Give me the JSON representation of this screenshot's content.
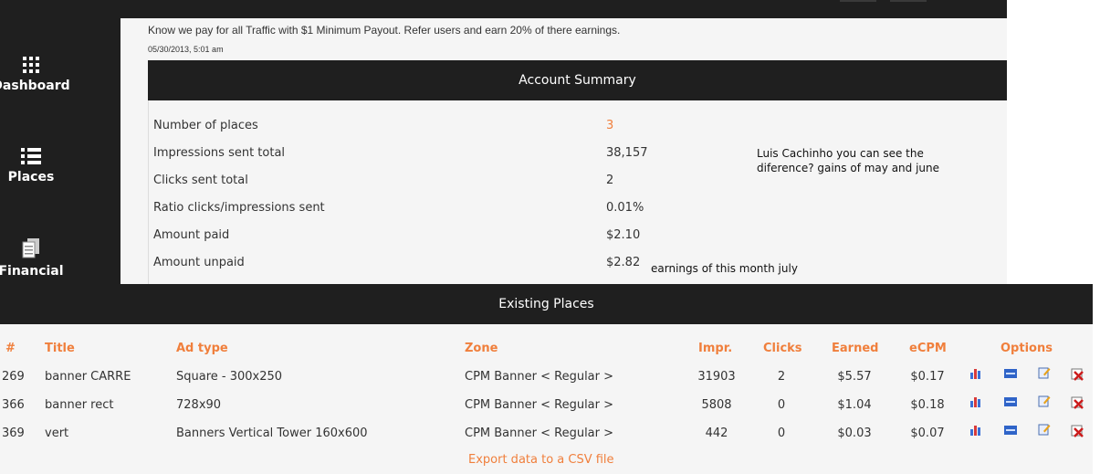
{
  "sidebar": {
    "items": [
      {
        "label": "Dashboard",
        "icon": "grid-icon"
      },
      {
        "label": "Places",
        "icon": "list-icon"
      },
      {
        "label": "Financial",
        "icon": "document-icon"
      }
    ]
  },
  "notice": {
    "text": "Know we pay for all Traffic with $1 Minimum Payout. Refer users and earn 20% of there earnings.",
    "date": "05/30/2013, 5:01 am"
  },
  "summary": {
    "title": "Account Summary",
    "rows": [
      {
        "label": "Number of places",
        "value": "3"
      },
      {
        "label": "Impressions sent total",
        "value": "38,157"
      },
      {
        "label": "Clicks sent total",
        "value": "2"
      },
      {
        "label": "Ratio clicks/impressions sent",
        "value": "0.01%"
      },
      {
        "label": "Amount paid",
        "value": "$2.10"
      },
      {
        "label": "Amount unpaid",
        "value": "$2.82"
      }
    ]
  },
  "annotations": {
    "note1_line1": "Luis Cachinho you can see the",
    "note1_line2": "diference?  gains of may and june",
    "note2": "earnings of this month july"
  },
  "places": {
    "title": "Existing Places",
    "columns": [
      "#",
      "Title",
      "Ad type",
      "Zone",
      "Impr.",
      "Clicks",
      "Earned",
      "eCPM",
      "Options"
    ],
    "rows": [
      {
        "id": "269",
        "title": "banner CARRE",
        "adtype": "Square - 300x250",
        "zone": "CPM Banner < Regular >",
        "impr": "31903",
        "clicks": "2",
        "earned": "$5.57",
        "ecpm": "$0.17"
      },
      {
        "id": "366",
        "title": "banner rect",
        "adtype": "728x90",
        "zone": "CPM Banner < Regular >",
        "impr": "5808",
        "clicks": "0",
        "earned": "$1.04",
        "ecpm": "$0.18"
      },
      {
        "id": "369",
        "title": "vert",
        "adtype": "Banners Vertical Tower 160x600",
        "zone": "CPM Banner < Regular >",
        "impr": "442",
        "clicks": "0",
        "earned": "$0.03",
        "ecpm": "$0.07"
      }
    ],
    "option_icons": [
      "stats-icon",
      "html-icon",
      "edit-icon",
      "delete-icon"
    ],
    "export_label": "Export data to a CSV file"
  },
  "colors": {
    "accent": "#f07f3c",
    "dark": "#1f1f1f",
    "panel": "#f5f5f5"
  }
}
